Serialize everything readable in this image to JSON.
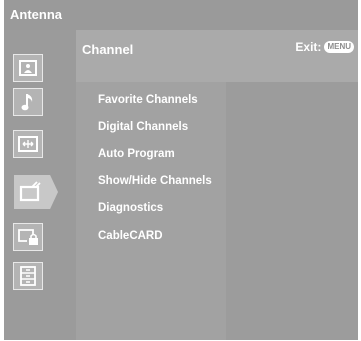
{
  "topbar": {
    "title": "Antenna"
  },
  "panel": {
    "title": "Channel",
    "exit_label": "Exit:",
    "exit_key": "MENU"
  },
  "sidebar": {
    "icons": [
      {
        "name": "picture-icon",
        "selected": false
      },
      {
        "name": "sound-icon",
        "selected": false
      },
      {
        "name": "screen-icon",
        "selected": false
      },
      {
        "name": "channel-icon",
        "selected": true
      },
      {
        "name": "parental-lock-icon",
        "selected": false
      },
      {
        "name": "setup-icon",
        "selected": false
      }
    ]
  },
  "menu": {
    "items": [
      {
        "label": "Favorite Channels"
      },
      {
        "label": "Digital Channels"
      },
      {
        "label": "Auto Program"
      },
      {
        "label": "Show/Hide Channels"
      },
      {
        "label": "Diagnostics"
      },
      {
        "label": "CableCARD"
      }
    ]
  },
  "colors": {
    "text": "#ffffff",
    "background": "#8d8d8d",
    "panel": "#aaaaaa",
    "selected_icon": "#c8c8c8"
  }
}
